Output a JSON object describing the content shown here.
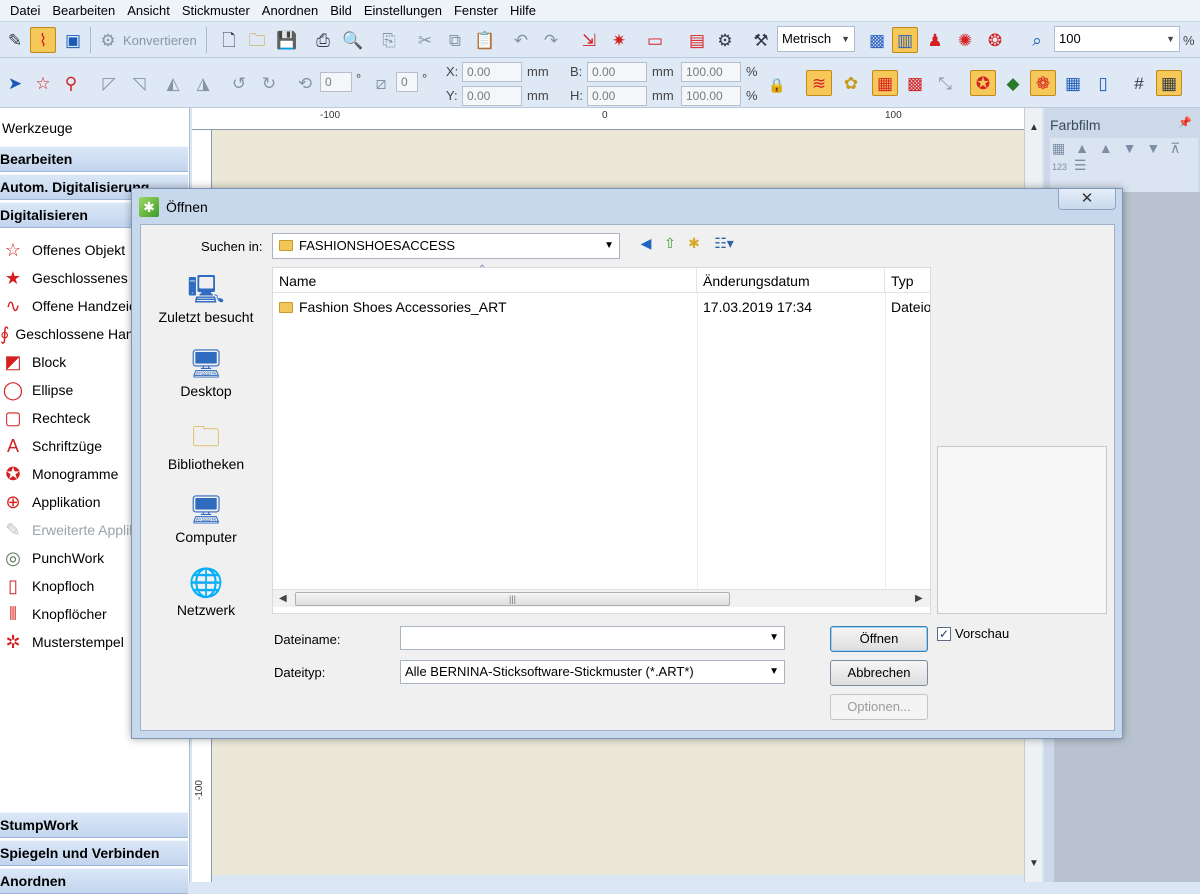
{
  "menubar": {
    "items": [
      "Datei",
      "Bearbeiten",
      "Ansicht",
      "Stickmuster",
      "Anordnen",
      "Bild",
      "Einstellungen",
      "Fenster",
      "Hilfe"
    ]
  },
  "toolbar1": {
    "convert_label": "Konvertieren",
    "units_value": "Metrisch",
    "zoom_value": "100",
    "zoom_unit": "%"
  },
  "toolbar2": {
    "rotate_value": "0",
    "degree_symbol": "°",
    "slant_value": "0",
    "x_label": "X:",
    "x_value": "0.00",
    "y_label": "Y:",
    "y_value": "0.00",
    "b_label": "B:",
    "b_value": "0.00",
    "h_label": "H:",
    "h_value": "0.00",
    "unit_mm": "mm",
    "scale_w": "100.00",
    "scale_h": "100.00",
    "percent": "%"
  },
  "leftpanel": {
    "title": "Werkzeuge",
    "headers_top": [
      "Bearbeiten",
      "Autom. Digitalisierung",
      "Digitalisieren"
    ],
    "tools": [
      {
        "label": "Offenes Objekt",
        "icon": "open-star-icon"
      },
      {
        "label": "Geschlossenes Objekt",
        "icon": "filled-star-icon"
      },
      {
        "label": "Offene Handzeichnung",
        "icon": "open-freehand-icon"
      },
      {
        "label": "Geschlossene Handzeichnung",
        "icon": "closed-freehand-icon"
      },
      {
        "label": "Block",
        "icon": "block-icon"
      },
      {
        "label": "Ellipse",
        "icon": "ellipse-icon"
      },
      {
        "label": "Rechteck",
        "icon": "rectangle-icon"
      },
      {
        "label": "Schriftzüge",
        "icon": "lettering-icon"
      },
      {
        "label": "Monogramme",
        "icon": "monogram-icon"
      },
      {
        "label": "Applikation",
        "icon": "applique-icon"
      },
      {
        "label": "Erweiterte Applikation",
        "icon": "advanced-applique-icon"
      },
      {
        "label": "PunchWork",
        "icon": "punchwork-icon"
      },
      {
        "label": "Knopfloch",
        "icon": "buttonhole-icon"
      },
      {
        "label": "Knopflöcher",
        "icon": "buttonholes-icon"
      },
      {
        "label": "Musterstempel",
        "icon": "pattern-stamp-icon"
      }
    ],
    "headers_bottom": [
      "StumpWork",
      "Spiegeln und Verbinden",
      "Anordnen"
    ]
  },
  "ruler": {
    "top_marks": [
      "-100",
      "0",
      "100"
    ],
    "left_marks": [
      "-100"
    ]
  },
  "rightpanel": {
    "title": "Farbfilm",
    "sub_label": "123"
  },
  "dialog": {
    "title": "Öffnen",
    "close_symbol": "✕",
    "look_in_label": "Suchen in:",
    "look_in_value": "FASHIONSHOESACCESS",
    "places": [
      "Zuletzt besucht",
      "Desktop",
      "Bibliotheken",
      "Computer",
      "Netzwerk"
    ],
    "columns": [
      "Name",
      "Änderungsdatum",
      "Typ"
    ],
    "files": [
      {
        "name": "Fashion Shoes Accessories_ART",
        "date": "17.03.2019 17:34",
        "type": "Dateiordner"
      }
    ],
    "filename_label": "Dateiname:",
    "filename_value": "",
    "filetype_label": "Dateityp:",
    "filetype_value": "Alle BERNINA-Sticksoftware-Stickmuster (*.ART*)",
    "open_button": "Öffnen",
    "cancel_button": "Abbrechen",
    "options_button": "Optionen...",
    "preview_label": "Vorschau",
    "preview_checked": true
  }
}
